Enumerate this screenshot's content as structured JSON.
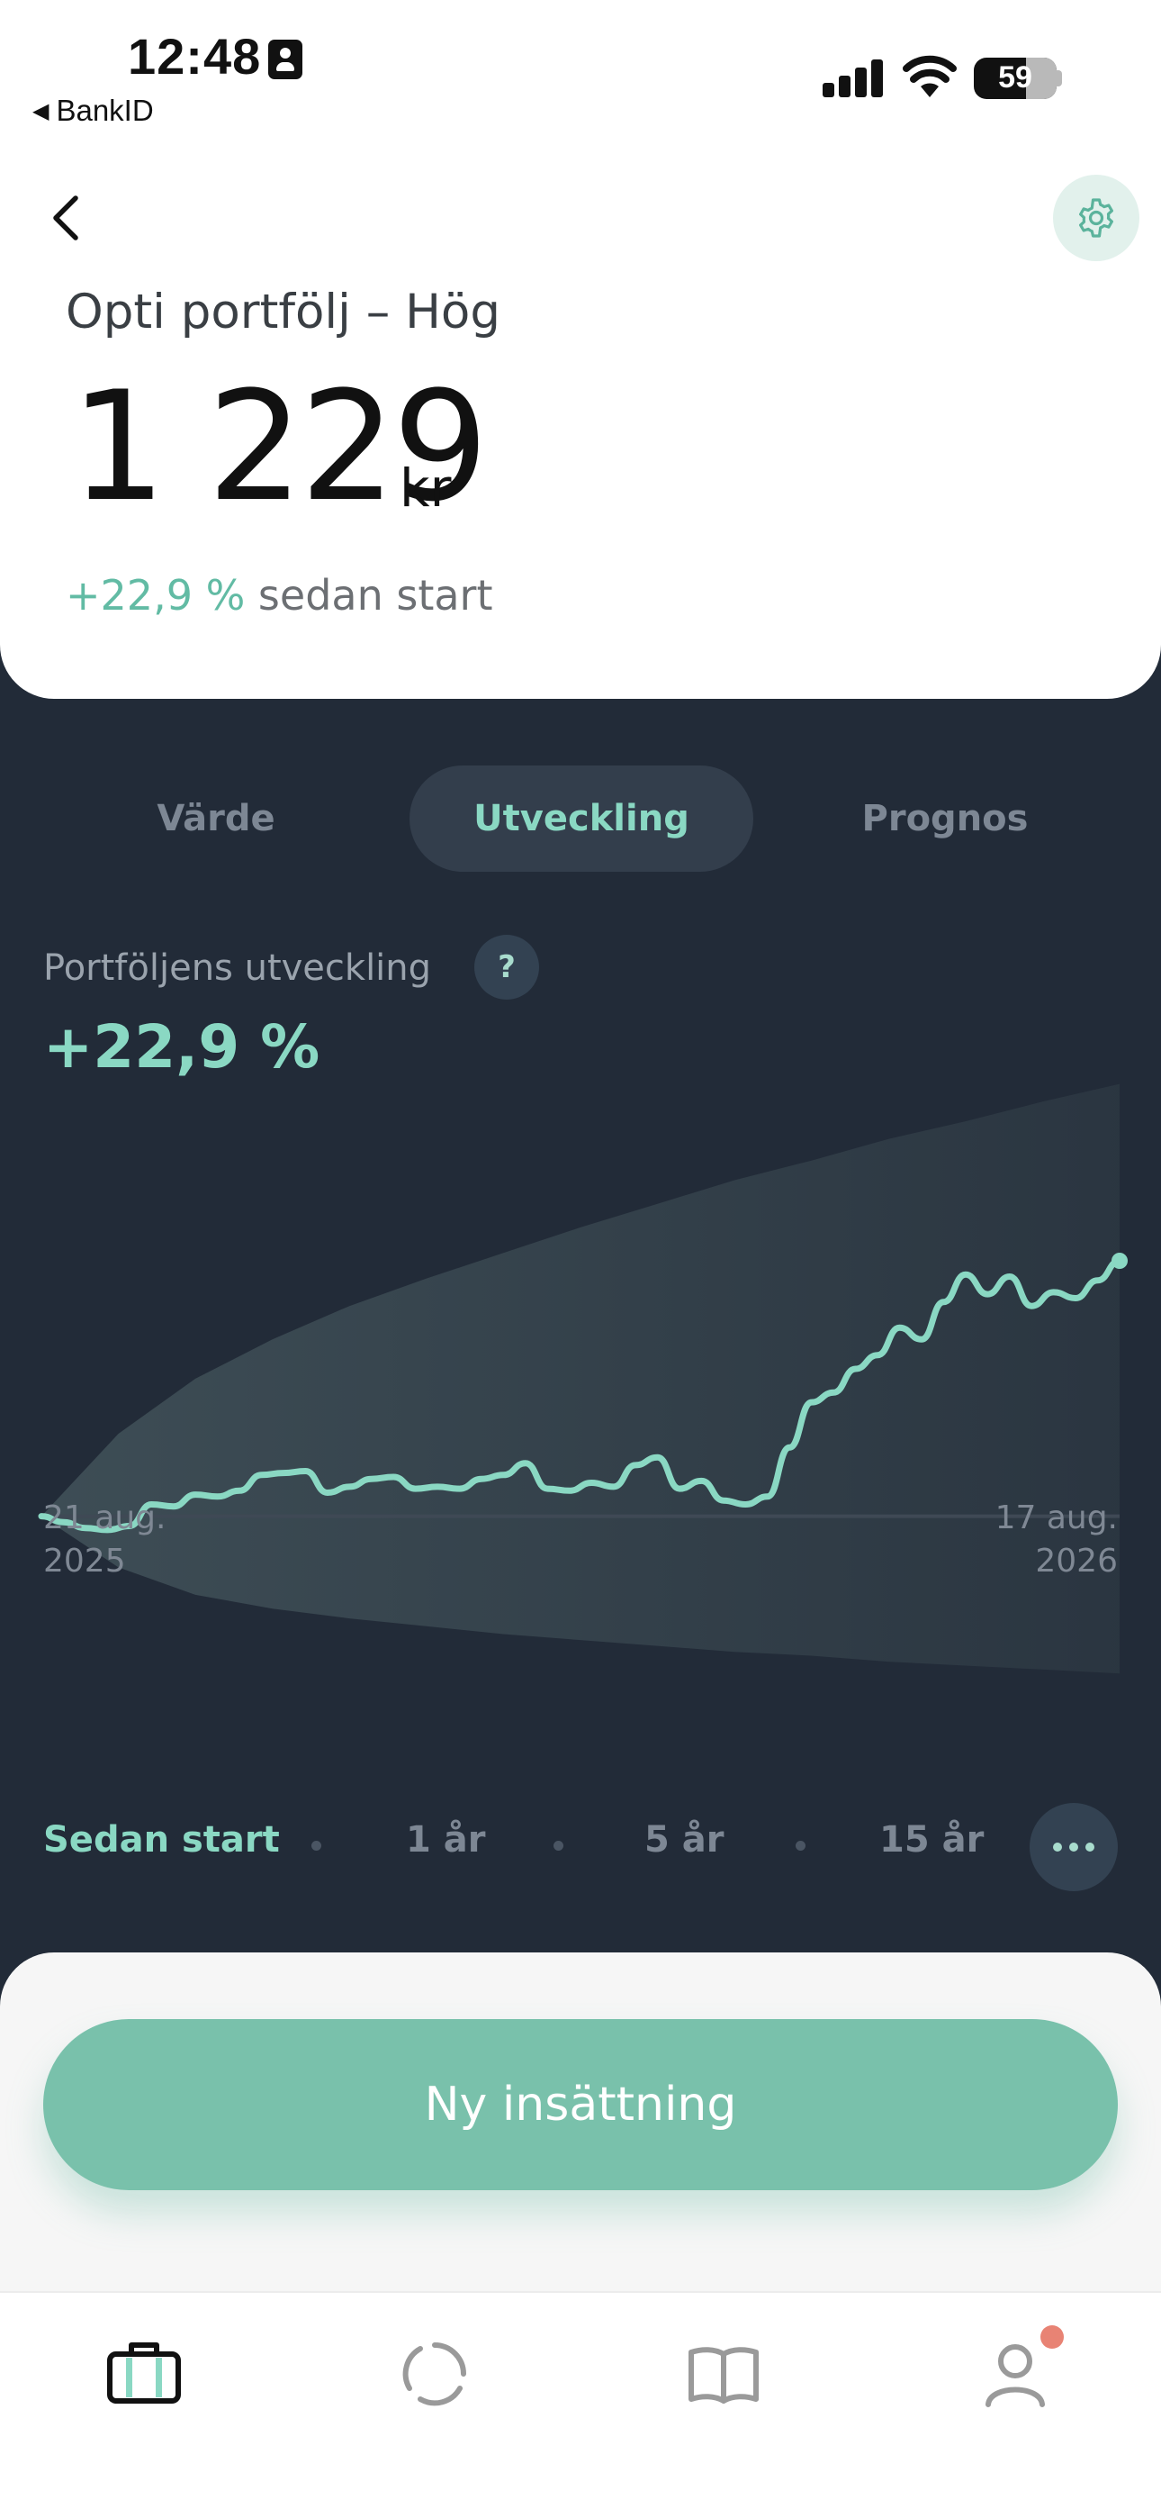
{
  "status_bar": {
    "time": "12:48",
    "back_app": "BankID",
    "battery": "59"
  },
  "header": {
    "portfolio_name": "Opti portfölj – Hög",
    "amount": "1 229",
    "currency": "kr",
    "change_value": "+22,9 %",
    "change_suffix": "sedan start"
  },
  "tabs": [
    {
      "label": "Värde",
      "active": false
    },
    {
      "label": "Utveckling",
      "active": true
    },
    {
      "label": "Prognos",
      "active": false
    }
  ],
  "performance": {
    "label": "Portföljens utveckling",
    "help": "?",
    "value": "+22,9 %"
  },
  "chart_data": {
    "type": "line",
    "title": "",
    "xlabel": "",
    "ylabel": "",
    "x_start_label": [
      "21 aug.",
      "2025"
    ],
    "x_end_label": [
      "17 aug.",
      "2026"
    ],
    "ylim": [
      -9,
      24
    ],
    "baseline": 0,
    "series": [
      {
        "values": [
          0,
          -0.3,
          -0.6,
          -0.7,
          -0.5,
          0.6,
          0.5,
          1.1,
          1.0,
          1.3,
          2.1,
          2.2,
          2.3,
          1.2,
          1.5,
          1.9,
          2.0,
          1.4,
          1.5,
          1.4,
          1.9,
          2.1,
          2.7,
          1.4,
          1.3,
          1.7,
          1.5,
          2.6,
          3.0,
          1.4,
          1.8,
          0.8,
          0.6,
          1.0,
          3.5,
          5.8,
          6.3,
          7.5,
          8.2,
          9.6,
          9.0,
          10.9,
          12.3,
          11.3,
          12.2,
          10.7,
          11.4,
          11.1,
          12.0,
          13.0
        ]
      }
    ],
    "forecast_band_upper": [
      0,
      4.2,
      7.0,
      9.0,
      10.7,
      12.1,
      13.4,
      14.7,
      15.9,
      17.1,
      18.1,
      19.2,
      20.1,
      21.1,
      22.0
    ],
    "forecast_band_lower": [
      0,
      -2.6,
      -4.0,
      -4.7,
      -5.2,
      -5.6,
      -6.0,
      -6.3,
      -6.6,
      -6.9,
      -7.1,
      -7.4,
      -7.6,
      -7.8,
      -8.0
    ],
    "colors": {
      "line": "#8ad8c3",
      "band": "#3b4a55",
      "baseline": "#3f4955"
    }
  },
  "periods": [
    {
      "label": "Sedan start",
      "active": true
    },
    {
      "label": "1 år",
      "active": false
    },
    {
      "label": "5 år",
      "active": false
    },
    {
      "label": "15 år",
      "active": false
    }
  ],
  "actions": {
    "deposit_label": "Ny insättning"
  },
  "nav": {
    "items": [
      "portfolio-icon",
      "activity-icon",
      "learn-icon",
      "profile-icon"
    ],
    "active_color": "#111111",
    "inactive_color": "#9a9a9a",
    "notification_color": "#e88374"
  },
  "colors": {
    "accent": "#8ad8c3",
    "button": "#79c1ab",
    "dark_bg": "#222b38"
  }
}
